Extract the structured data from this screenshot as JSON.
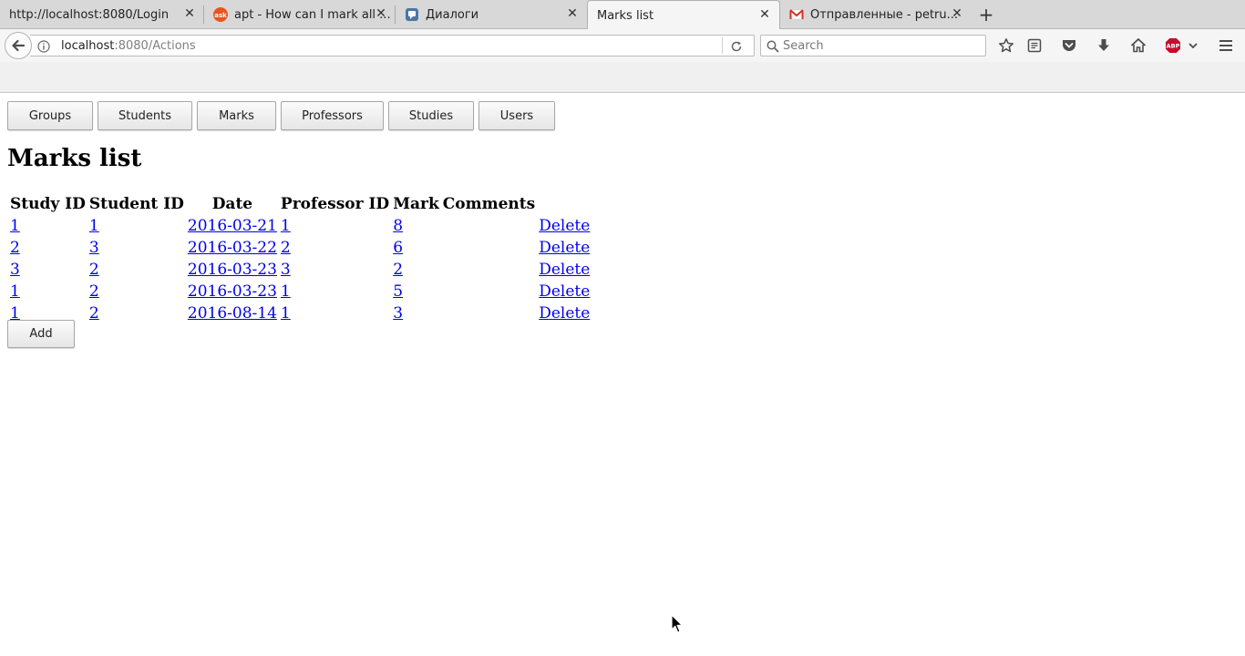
{
  "browser": {
    "tabs": [
      {
        "title": "http://localhost:8080/Login",
        "favicon": "none",
        "active": false
      },
      {
        "title": "apt - How can I mark all ...",
        "favicon": "askubuntu-icon",
        "active": false
      },
      {
        "title": "Диалоги",
        "favicon": "chat-icon",
        "active": false
      },
      {
        "title": "Marks list",
        "favicon": "none",
        "active": true
      },
      {
        "title": "Отправленные - petru...",
        "favicon": "gmail-icon",
        "active": false
      }
    ],
    "new_tab_label": "+",
    "url": {
      "host": "localhost",
      "rest": ":8080/Actions"
    },
    "search_placeholder": "Search",
    "toolbar_icons": [
      "bookmark-star-icon",
      "reading-list-icon",
      "pocket-icon",
      "download-icon",
      "home-icon",
      "adblock-icon",
      "menu-icon"
    ],
    "adblock_label": "ABP"
  },
  "page": {
    "menu": [
      "Groups",
      "Students",
      "Marks",
      "Professors",
      "Studies",
      "Users"
    ],
    "title": "Marks list",
    "table": {
      "headers": [
        "Study ID",
        "Student ID",
        "Date",
        "Professor ID",
        "Mark",
        "Comments",
        ""
      ],
      "rows": [
        {
          "study_id": "1",
          "student_id": "1",
          "date": "2016-03-21",
          "professor_id": "1",
          "mark": "8",
          "comments": "",
          "action": "Delete"
        },
        {
          "study_id": "2",
          "student_id": "3",
          "date": "2016-03-22",
          "professor_id": "2",
          "mark": "6",
          "comments": "",
          "action": "Delete"
        },
        {
          "study_id": "3",
          "student_id": "2",
          "date": "2016-03-23",
          "professor_id": "3",
          "mark": "2",
          "comments": "",
          "action": "Delete"
        },
        {
          "study_id": "1",
          "student_id": "2",
          "date": "2016-03-23",
          "professor_id": "1",
          "mark": "5",
          "comments": "",
          "action": "Delete"
        },
        {
          "study_id": "1",
          "student_id": "2",
          "date": "2016-08-14",
          "professor_id": "1",
          "mark": "3",
          "comments": "",
          "action": "Delete"
        }
      ]
    },
    "add_label": "Add"
  },
  "colors": {
    "link": "#0000ee",
    "gmail_red": "#d93025",
    "askubuntu_orange": "#e95420",
    "chat_blue": "#4a76a8",
    "abp_red": "#c70d2c"
  }
}
